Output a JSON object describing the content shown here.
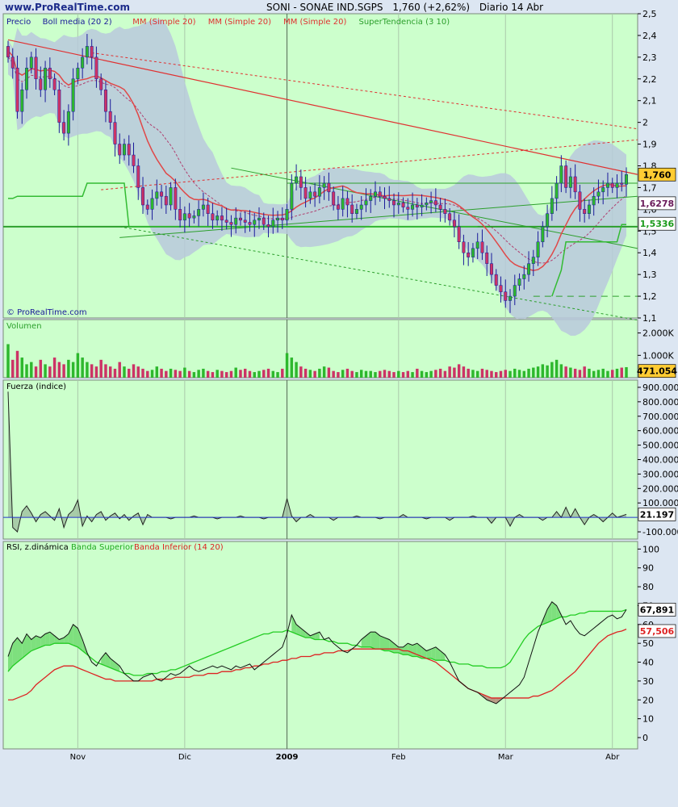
{
  "header": {
    "site": "www.ProRealTime.com",
    "symbol": "SONI - SONAE IND.SGPS",
    "last": "1,760 (+2,62%)",
    "period": "Diario 14 Abr"
  },
  "colors": {
    "panel_bg": "#ccffcc",
    "page_bg": "#dce6f2",
    "bull": "#2db82d",
    "bear": "#cc3366",
    "boll": "#6a8cc7",
    "red_line": "#e03030",
    "green_line": "#2c9f2c"
  },
  "chart_data": [
    {
      "type": "candlestick",
      "panel": "price",
      "legend": [
        "Precio",
        "Boll media (20 2)",
        "MM (Simple 20)",
        "MM (Simple 20)",
        "MM (Simple 20)",
        "SuperTendencia (3 10)"
      ],
      "watermark": "© ProRealTime.com",
      "ylim": [
        1.1,
        2.5
      ],
      "yticks": [
        "2,5",
        "2,4",
        "2,3",
        "2,2",
        "2,1",
        "2",
        "1,9",
        "1,8",
        "1,7",
        "1,6",
        "1,5",
        "1,4",
        "1,3",
        "1,2",
        "1,1"
      ],
      "ytick_values": [
        2.5,
        2.4,
        2.3,
        2.2,
        2.1,
        2.0,
        1.9,
        1.8,
        1.7,
        1.6,
        1.5,
        1.4,
        1.3,
        1.2,
        1.1
      ],
      "xticks": [
        "Nov",
        "Dic",
        "2009",
        "Feb",
        "Mar",
        "Abr"
      ],
      "xtick_index": [
        15,
        38,
        60,
        84,
        107,
        130
      ],
      "close": [
        2.3,
        2.25,
        2.05,
        2.15,
        2.25,
        2.3,
        2.2,
        2.15,
        2.25,
        2.2,
        2.15,
        2.0,
        1.95,
        2.05,
        2.2,
        2.25,
        2.3,
        2.35,
        2.3,
        2.2,
        2.15,
        2.05,
        2.0,
        1.9,
        1.85,
        1.9,
        1.85,
        1.8,
        1.7,
        1.62,
        1.6,
        1.65,
        1.68,
        1.66,
        1.62,
        1.7,
        1.6,
        1.55,
        1.58,
        1.56,
        1.57,
        1.6,
        1.62,
        1.58,
        1.55,
        1.57,
        1.55,
        1.54,
        1.53,
        1.56,
        1.55,
        1.54,
        1.53,
        1.55,
        1.56,
        1.53,
        1.52,
        1.55,
        1.56,
        1.55,
        1.6,
        1.72,
        1.75,
        1.7,
        1.65,
        1.68,
        1.66,
        1.7,
        1.72,
        1.68,
        1.62,
        1.6,
        1.65,
        1.62,
        1.58,
        1.6,
        1.62,
        1.64,
        1.66,
        1.68,
        1.66,
        1.65,
        1.64,
        1.62,
        1.63,
        1.61,
        1.6,
        1.62,
        1.61,
        1.62,
        1.63,
        1.64,
        1.62,
        1.6,
        1.58,
        1.55,
        1.52,
        1.45,
        1.4,
        1.38,
        1.42,
        1.45,
        1.4,
        1.35,
        1.3,
        1.25,
        1.22,
        1.18,
        1.2,
        1.25,
        1.28,
        1.3,
        1.35,
        1.38,
        1.45,
        1.52,
        1.58,
        1.65,
        1.72,
        1.8,
        1.7,
        1.75,
        1.68,
        1.6,
        1.58,
        1.62,
        1.66,
        1.68,
        1.7,
        1.72,
        1.7,
        1.72,
        1.715,
        1.76
      ],
      "supertrend_ylabel": "1,5336",
      "boll_mid_label": "1,6278",
      "last_label": "1,760"
    },
    {
      "type": "bar",
      "panel": "volume",
      "legend": [
        "Volumen"
      ],
      "yticks": [
        "2.000K",
        "1.000K"
      ],
      "ytick_values": [
        2000,
        1000
      ],
      "ylim": [
        0,
        2600
      ],
      "last_label": "471.054",
      "values": [
        1500,
        800,
        1200,
        900,
        600,
        700,
        500,
        800,
        600,
        500,
        900,
        700,
        600,
        800,
        700,
        1100,
        900,
        700,
        600,
        500,
        800,
        600,
        500,
        400,
        700,
        500,
        400,
        600,
        500,
        400,
        300,
        350,
        500,
        400,
        300,
        400,
        350,
        300,
        450,
        300,
        250,
        350,
        400,
        300,
        250,
        350,
        300,
        250,
        300,
        450,
        350,
        400,
        300,
        250,
        300,
        350,
        400,
        300,
        250,
        400,
        1100,
        900,
        700,
        500,
        400,
        350,
        300,
        400,
        500,
        450,
        300,
        250,
        350,
        400,
        300,
        250,
        350,
        300,
        300,
        250,
        300,
        350,
        300,
        250,
        300,
        250,
        300,
        250,
        400,
        300,
        250,
        300,
        350,
        400,
        300,
        500,
        450,
        600,
        500,
        400,
        350,
        300,
        400,
        350,
        300,
        250,
        300,
        350,
        300,
        400,
        350,
        300,
        400,
        450,
        500,
        600,
        550,
        700,
        800,
        600,
        500,
        450,
        400,
        350,
        500,
        400,
        300,
        350,
        400,
        300,
        350,
        400,
        450,
        471
      ]
    },
    {
      "type": "line",
      "panel": "fuerza",
      "legend": [
        "Fuerza (indice)"
      ],
      "ylim": [
        -150000,
        950000
      ],
      "yticks": [
        "900.000",
        "800.000",
        "700.000",
        "600.000",
        "500.000",
        "400.000",
        "300.000",
        "200.000",
        "100.000",
        "-100.000"
      ],
      "ytick_values": [
        900000,
        800000,
        700000,
        600000,
        500000,
        400000,
        300000,
        200000,
        100000,
        -100000
      ],
      "last_label": "21.197",
      "spikes": [
        [
          0,
          870000
        ],
        [
          1,
          -70000
        ],
        [
          2,
          -100000
        ],
        [
          3,
          40000
        ],
        [
          4,
          80000
        ],
        [
          5,
          30000
        ],
        [
          6,
          -30000
        ],
        [
          7,
          20000
        ],
        [
          8,
          40000
        ],
        [
          9,
          10000
        ],
        [
          10,
          -20000
        ],
        [
          11,
          60000
        ],
        [
          12,
          -70000
        ],
        [
          13,
          20000
        ],
        [
          14,
          50000
        ],
        [
          15,
          120000
        ],
        [
          16,
          -60000
        ],
        [
          17,
          10000
        ],
        [
          18,
          -30000
        ],
        [
          19,
          20000
        ],
        [
          20,
          40000
        ],
        [
          21,
          -20000
        ],
        [
          22,
          10000
        ],
        [
          23,
          30000
        ],
        [
          24,
          -10000
        ],
        [
          25,
          20000
        ],
        [
          26,
          -20000
        ],
        [
          27,
          10000
        ],
        [
          28,
          30000
        ],
        [
          29,
          -50000
        ],
        [
          30,
          20000
        ],
        [
          35,
          -10000
        ],
        [
          40,
          10000
        ],
        [
          45,
          -10000
        ],
        [
          50,
          10000
        ],
        [
          55,
          -10000
        ],
        [
          60,
          130000
        ],
        [
          61,
          10000
        ],
        [
          62,
          -30000
        ],
        [
          65,
          20000
        ],
        [
          70,
          -20000
        ],
        [
          75,
          10000
        ],
        [
          80,
          -10000
        ],
        [
          85,
          20000
        ],
        [
          90,
          -10000
        ],
        [
          95,
          -20000
        ],
        [
          100,
          10000
        ],
        [
          104,
          -40000
        ],
        [
          108,
          -60000
        ],
        [
          110,
          20000
        ],
        [
          115,
          -20000
        ],
        [
          118,
          40000
        ],
        [
          120,
          70000
        ],
        [
          122,
          60000
        ],
        [
          124,
          -50000
        ],
        [
          126,
          20000
        ],
        [
          128,
          -30000
        ],
        [
          130,
          30000
        ],
        [
          132,
          10000
        ],
        [
          133,
          21197
        ]
      ]
    },
    {
      "type": "line",
      "panel": "rsi",
      "legend": [
        "RSI, z.dinámica",
        "Banda Superior",
        "Banda Inferior (14 20)"
      ],
      "ylim": [
        -6,
        104
      ],
      "yticks": [
        "100",
        "90",
        "80",
        "70",
        "60",
        "50",
        "40",
        "30",
        "20",
        "10",
        "0"
      ],
      "ytick_values": [
        100,
        90,
        80,
        70,
        60,
        50,
        40,
        30,
        20,
        10,
        0
      ],
      "last_labels": [
        "67,891",
        "57,506"
      ],
      "rsi": [
        43,
        50,
        53,
        50,
        55,
        52,
        54,
        53,
        55,
        56,
        54,
        52,
        53,
        55,
        60,
        58,
        52,
        45,
        40,
        38,
        42,
        45,
        42,
        40,
        38,
        34,
        32,
        30,
        30,
        32,
        33,
        34,
        31,
        30,
        32,
        34,
        33,
        34,
        36,
        38,
        36,
        35,
        36,
        37,
        38,
        37,
        38,
        37,
        36,
        38,
        37,
        38,
        39,
        36,
        38,
        40,
        42,
        44,
        46,
        48,
        55,
        65,
        60,
        58,
        56,
        54,
        55,
        56,
        52,
        53,
        50,
        48,
        46,
        45,
        47,
        49,
        52,
        54,
        56,
        56,
        54,
        53,
        52,
        50,
        48,
        48,
        50,
        49,
        50,
        48,
        46,
        47,
        48,
        46,
        44,
        40,
        35,
        30,
        28,
        26,
        25,
        24,
        22,
        20,
        19,
        18,
        20,
        22,
        24,
        26,
        28,
        32,
        40,
        48,
        56,
        62,
        68,
        72,
        70,
        65,
        60,
        62,
        58,
        55,
        54,
        56,
        58,
        60,
        62,
        64,
        65,
        63,
        64,
        67.9
      ],
      "upper": [
        35,
        38,
        40,
        42,
        44,
        46,
        47,
        48,
        49,
        49,
        50,
        50,
        50,
        50,
        49,
        48,
        46,
        44,
        42,
        40,
        39,
        38,
        37,
        36,
        35,
        34,
        34,
        33,
        33,
        33,
        34,
        34,
        34,
        35,
        35,
        36,
        36,
        37,
        38,
        39,
        40,
        41,
        42,
        43,
        44,
        45,
        46,
        47,
        48,
        49,
        50,
        51,
        52,
        53,
        54,
        55,
        55,
        56,
        56,
        56,
        57,
        56,
        55,
        54,
        53,
        53,
        52,
        52,
        52,
        51,
        51,
        50,
        50,
        50,
        49,
        49,
        48,
        48,
        48,
        47,
        47,
        46,
        46,
        45,
        45,
        44,
        44,
        43,
        43,
        42,
        42,
        42,
        41,
        41,
        41,
        40,
        40,
        39,
        39,
        39,
        38,
        38,
        38,
        37,
        37,
        37,
        37,
        38,
        40,
        44,
        48,
        52,
        55,
        57,
        59,
        60,
        61,
        62,
        63,
        64,
        64,
        65,
        65,
        66,
        66,
        67,
        67,
        67,
        67,
        67,
        67,
        67,
        67,
        67.9
      ],
      "lower": [
        20,
        20,
        21,
        22,
        23,
        25,
        28,
        30,
        32,
        34,
        36,
        37,
        38,
        38,
        38,
        37,
        36,
        35,
        34,
        33,
        32,
        31,
        31,
        30,
        30,
        30,
        30,
        30,
        30,
        30,
        30,
        30,
        31,
        31,
        31,
        31,
        32,
        32,
        32,
        32,
        33,
        33,
        33,
        34,
        34,
        34,
        35,
        35,
        35,
        36,
        36,
        37,
        37,
        38,
        38,
        39,
        39,
        40,
        40,
        41,
        41,
        42,
        42,
        43,
        43,
        43,
        44,
        44,
        45,
        45,
        45,
        46,
        46,
        46,
        47,
        47,
        47,
        47,
        47,
        47,
        47,
        47,
        47,
        47,
        47,
        46,
        46,
        45,
        44,
        43,
        42,
        41,
        40,
        38,
        36,
        34,
        32,
        30,
        28,
        26,
        25,
        24,
        23,
        22,
        21,
        21,
        21,
        21,
        21,
        21,
        21,
        21,
        21,
        22,
        22,
        23,
        24,
        25,
        27,
        29,
        31,
        33,
        35,
        38,
        41,
        44,
        47,
        50,
        52,
        54,
        55,
        56,
        56.5,
        57.5
      ]
    }
  ]
}
